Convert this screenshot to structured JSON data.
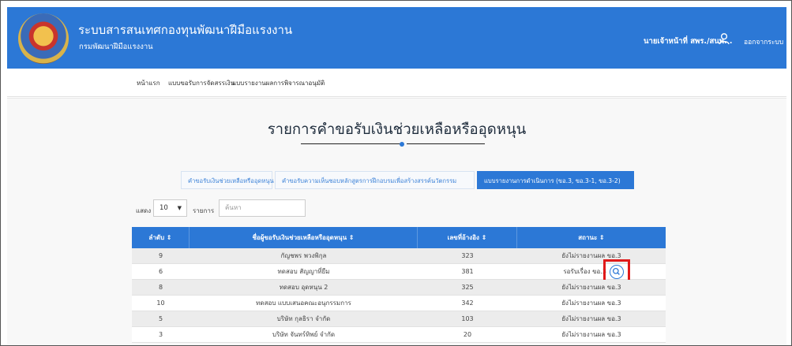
{
  "header": {
    "system_name": "ระบบสารสนเทศกองทุนพัฒนาฝีมือแรงงาน",
    "department": "กรมพัฒนาฝีมือแรงงาน",
    "user_name": "นายเจ้าหน้าที่ สพร./สนพ. .",
    "logout_label": "ออกจากระบบ",
    "brand_color": "#2c78d6"
  },
  "nav": {
    "items": [
      {
        "label": "หน้าแรก"
      },
      {
        "label": "แบบขอรับการจัดสรรเงิน"
      },
      {
        "label": "แบบรายงานผลการพิจารณาอนุมัติ"
      }
    ]
  },
  "main": {
    "title": "รายการคำขอรับเงินช่วยเหลือหรืออุดหนุน",
    "tabs": [
      {
        "label": "คำขอรับเงินช่วยเหลือหรืออุดหนุน",
        "active": false
      },
      {
        "label": "คำขอรับความเห็นชอบหลักสูตรการฝึกอบรมเพื่อสร้างสรรค์นวัตกรรม",
        "active": false
      },
      {
        "label": "แบบรายงานการดำเนินการ (ขอ.3, ขอ.3-1, ขอ.3-2)",
        "active": true
      }
    ],
    "length_menu": {
      "show_label": "แสดง",
      "selected": "10",
      "items_label": "รายการ"
    },
    "search": {
      "placeholder": "ค้นหา"
    },
    "table": {
      "columns": [
        "ลำดับ ⇕",
        "ชื่อผู้ขอรับเงินช่วยเหลือหรืออุดหนุน ⇕",
        "เลขที่อ้างอิง ⇕",
        "สถานะ ⇕"
      ],
      "rows": [
        {
          "no": "9",
          "name": "กัญชพร พวงพิกุล",
          "ref": "323",
          "status": "ยังไม่รายงานผล ขอ.3"
        },
        {
          "no": "6",
          "name": "ทดสอบ สัญญาที่ยืม",
          "ref": "381",
          "status": "รอรับเรื่อง ขอ.3"
        },
        {
          "no": "8",
          "name": "ทดสอบ อุดหนุน 2",
          "ref": "325",
          "status": "ยังไม่รายงานผล ขอ.3"
        },
        {
          "no": "10",
          "name": "ทดสอบ แบบเสนอคณะอนุกรรมการ",
          "ref": "342",
          "status": "ยังไม่รายงานผล ขอ.3"
        },
        {
          "no": "5",
          "name": "บริษัท กุลธิรา จำกัด",
          "ref": "103",
          "status": "ยังไม่รายงานผล ขอ.3"
        },
        {
          "no": "3",
          "name": "บริษัท จันทร์ทิพย์ จำกัด",
          "ref": "20",
          "status": "ยังไม่รายงานผล ขอ.3"
        }
      ],
      "view_icon": "magnifier-icon"
    }
  }
}
